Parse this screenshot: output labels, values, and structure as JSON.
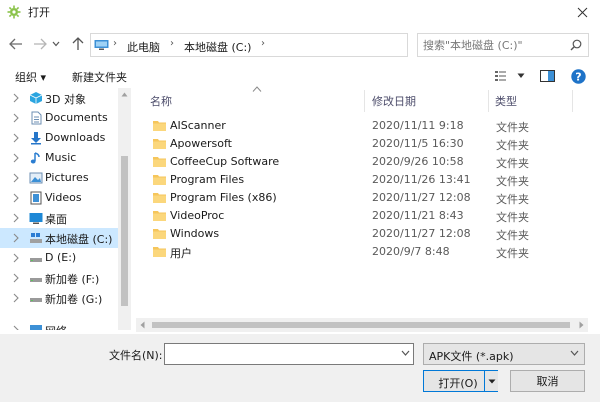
{
  "window": {
    "title": "打开"
  },
  "nav": {
    "breadcrumb": [
      "此电脑",
      "本地磁盘 (C:)"
    ],
    "search_placeholder": "搜索\"本地磁盘 (C:)\""
  },
  "toolbar": {
    "organize_label": "组织 ▾",
    "new_folder_label": "新建文件夹"
  },
  "sidebar": {
    "items": [
      {
        "label": "3D 对象",
        "icon": "3d-objects-icon"
      },
      {
        "label": "Documents",
        "icon": "documents-icon"
      },
      {
        "label": "Downloads",
        "icon": "downloads-icon"
      },
      {
        "label": "Music",
        "icon": "music-icon"
      },
      {
        "label": "Pictures",
        "icon": "pictures-icon"
      },
      {
        "label": "Videos",
        "icon": "videos-icon"
      },
      {
        "label": "桌面",
        "icon": "desktop-icon"
      },
      {
        "label": "本地磁盘 (C:)",
        "icon": "drive-icon",
        "selected": true
      },
      {
        "label": "D (E:)",
        "icon": "drive-icon"
      },
      {
        "label": "新加卷 (F:)",
        "icon": "drive-icon"
      },
      {
        "label": "新加卷 (G:)",
        "icon": "drive-icon"
      },
      {
        "label": "网络",
        "icon": "network-icon"
      }
    ]
  },
  "columns": {
    "name": "名称",
    "modified": "修改日期",
    "type": "类型"
  },
  "files": [
    {
      "name": "AIScanner",
      "modified": "2020/11/11 9:18",
      "type": "文件夹"
    },
    {
      "name": "Apowersoft",
      "modified": "2020/11/5 16:30",
      "type": "文件夹"
    },
    {
      "name": "CoffeeCup Software",
      "modified": "2020/9/26 10:58",
      "type": "文件夹"
    },
    {
      "name": "Program Files",
      "modified": "2020/11/26 13:41",
      "type": "文件夹"
    },
    {
      "name": "Program Files (x86)",
      "modified": "2020/11/27 12:08",
      "type": "文件夹"
    },
    {
      "name": "VideoProc",
      "modified": "2020/11/21 8:43",
      "type": "文件夹"
    },
    {
      "name": "Windows",
      "modified": "2020/11/27 12:08",
      "type": "文件夹"
    },
    {
      "name": "用户",
      "modified": "2020/9/7 8:48",
      "type": "文件夹"
    }
  ],
  "footer": {
    "filename_label": "文件名(N):",
    "filename_value": "",
    "filetype_value": "APK文件 (*.apk)",
    "open_label": "打开(O)",
    "cancel_label": "取消"
  },
  "colors": {
    "accent": "#0078d7",
    "selection": "#cce8ff",
    "folder": "#f6c65b"
  }
}
